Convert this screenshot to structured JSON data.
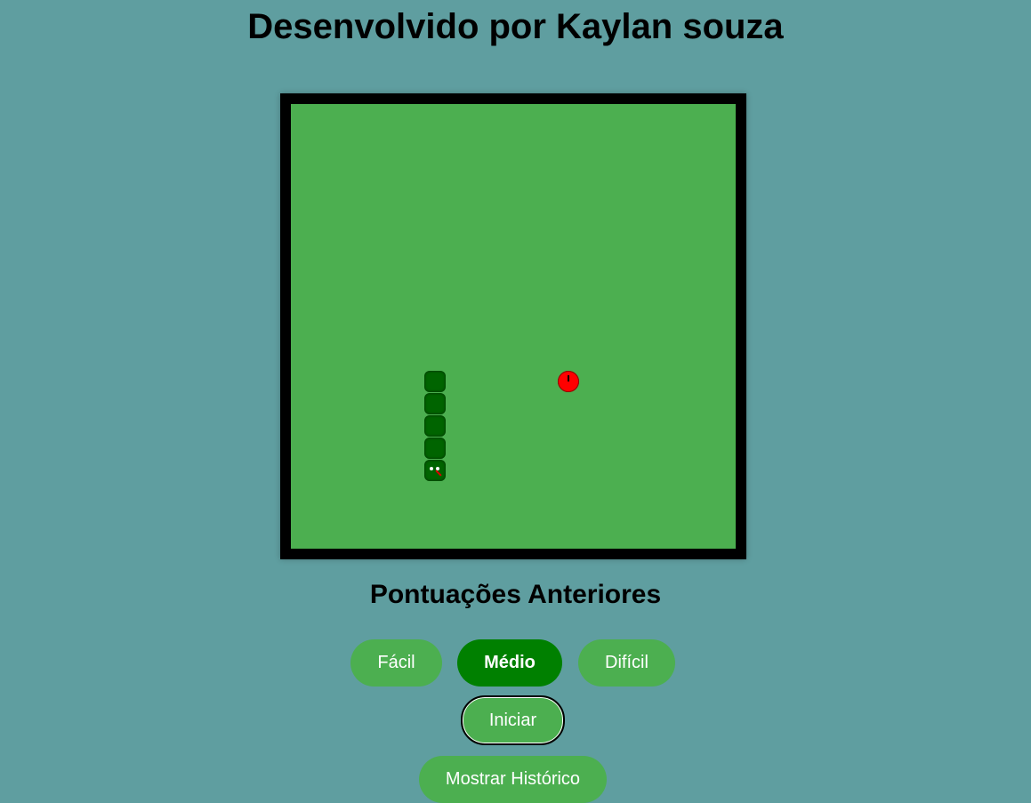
{
  "header": {
    "title": "Desenvolvido por Kaylan souza"
  },
  "game": {
    "grid_cells": 20,
    "snake": [
      {
        "col": 6,
        "row": 12
      },
      {
        "col": 6,
        "row": 13
      },
      {
        "col": 6,
        "row": 14
      },
      {
        "col": 6,
        "row": 15
      },
      {
        "col": 6,
        "row": 16
      }
    ],
    "snake_head_index": 4,
    "food": {
      "col": 12,
      "row": 12
    },
    "colors": {
      "board": "#4caf50",
      "snake": "#006400",
      "food": "#ff0000",
      "border": "#000000"
    }
  },
  "scores": {
    "heading": "Pontuações Anteriores"
  },
  "difficulty": {
    "easy_label": "Fácil",
    "medium_label": "Médio",
    "hard_label": "Difícil",
    "selected": "Médio"
  },
  "controls": {
    "start_label": "Iniciar",
    "history_label": "Mostrar Histórico"
  }
}
